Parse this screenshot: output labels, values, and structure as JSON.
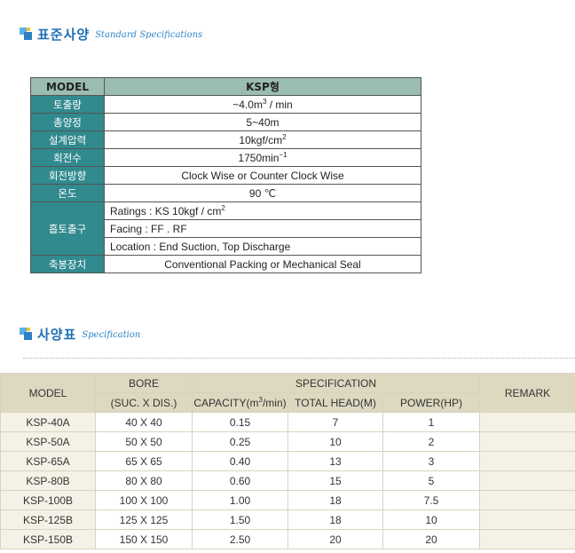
{
  "section1": {
    "title": "표준사양",
    "subtitle": "Standard Specifications"
  },
  "section2": {
    "title": "사양표",
    "subtitle": "Specification"
  },
  "standard_specs": {
    "header": {
      "label": "MODEL",
      "value": "KSP형"
    },
    "rows": [
      {
        "label": "토출량",
        "value": "~4.0m",
        "sup": "3",
        "suffix": " / min"
      },
      {
        "label": "총양정",
        "value": "5~40m"
      },
      {
        "label": "설계압력",
        "value": "10kgf/cm",
        "sup": "2",
        "suffix": ""
      },
      {
        "label": "회전수",
        "value": "1750min",
        "sup": "−1",
        "suffix": ""
      },
      {
        "label": "회전방향",
        "value": "Clock Wise or Counter Clock Wise"
      },
      {
        "label": "온도",
        "value": "90 ℃"
      }
    ],
    "nozzle": {
      "label": "흡토출구",
      "ratings_prefix": "Ratings : KS 10kgf / cm",
      "ratings_sup": "2",
      "facing": "Facing : FF . RF",
      "location": "Location : End Suction, Top Discharge"
    },
    "seal": {
      "label": "축봉장치",
      "value": "Conventional Packing or Mechanical Seal"
    }
  },
  "spec_table": {
    "headers": {
      "model": "MODEL",
      "bore": "BORE",
      "bore_sub": "(SUC. X DIS.)",
      "specification": "SPECIFICATION",
      "capacity_prefix": "CAPACITY(m",
      "capacity_sup": "3",
      "capacity_suffix": "/min)",
      "total_head": "TOTAL HEAD(M)",
      "power": "POWER(HP)",
      "remark": "REMARK"
    },
    "rows": [
      {
        "model": "KSP-40A",
        "bore": "40 X 40",
        "capacity": "0.15",
        "head": "7",
        "power": "1"
      },
      {
        "model": "KSP-50A",
        "bore": "50 X 50",
        "capacity": "0.25",
        "head": "10",
        "power": "2"
      },
      {
        "model": "KSP-65A",
        "bore": "65 X 65",
        "capacity": "0.40",
        "head": "13",
        "power": "3"
      },
      {
        "model": "KSP-80B",
        "bore": "80 X 80",
        "capacity": "0.60",
        "head": "15",
        "power": "5"
      },
      {
        "model": "KSP-100B",
        "bore": "100 X 100",
        "capacity": "1.00",
        "head": "18",
        "power": "7.5"
      },
      {
        "model": "KSP-125B",
        "bore": "125 X 125",
        "capacity": "1.50",
        "head": "18",
        "power": "10"
      },
      {
        "model": "KSP-150B",
        "bore": "150 X 150",
        "capacity": "2.50",
        "head": "20",
        "power": "20"
      }
    ]
  }
}
